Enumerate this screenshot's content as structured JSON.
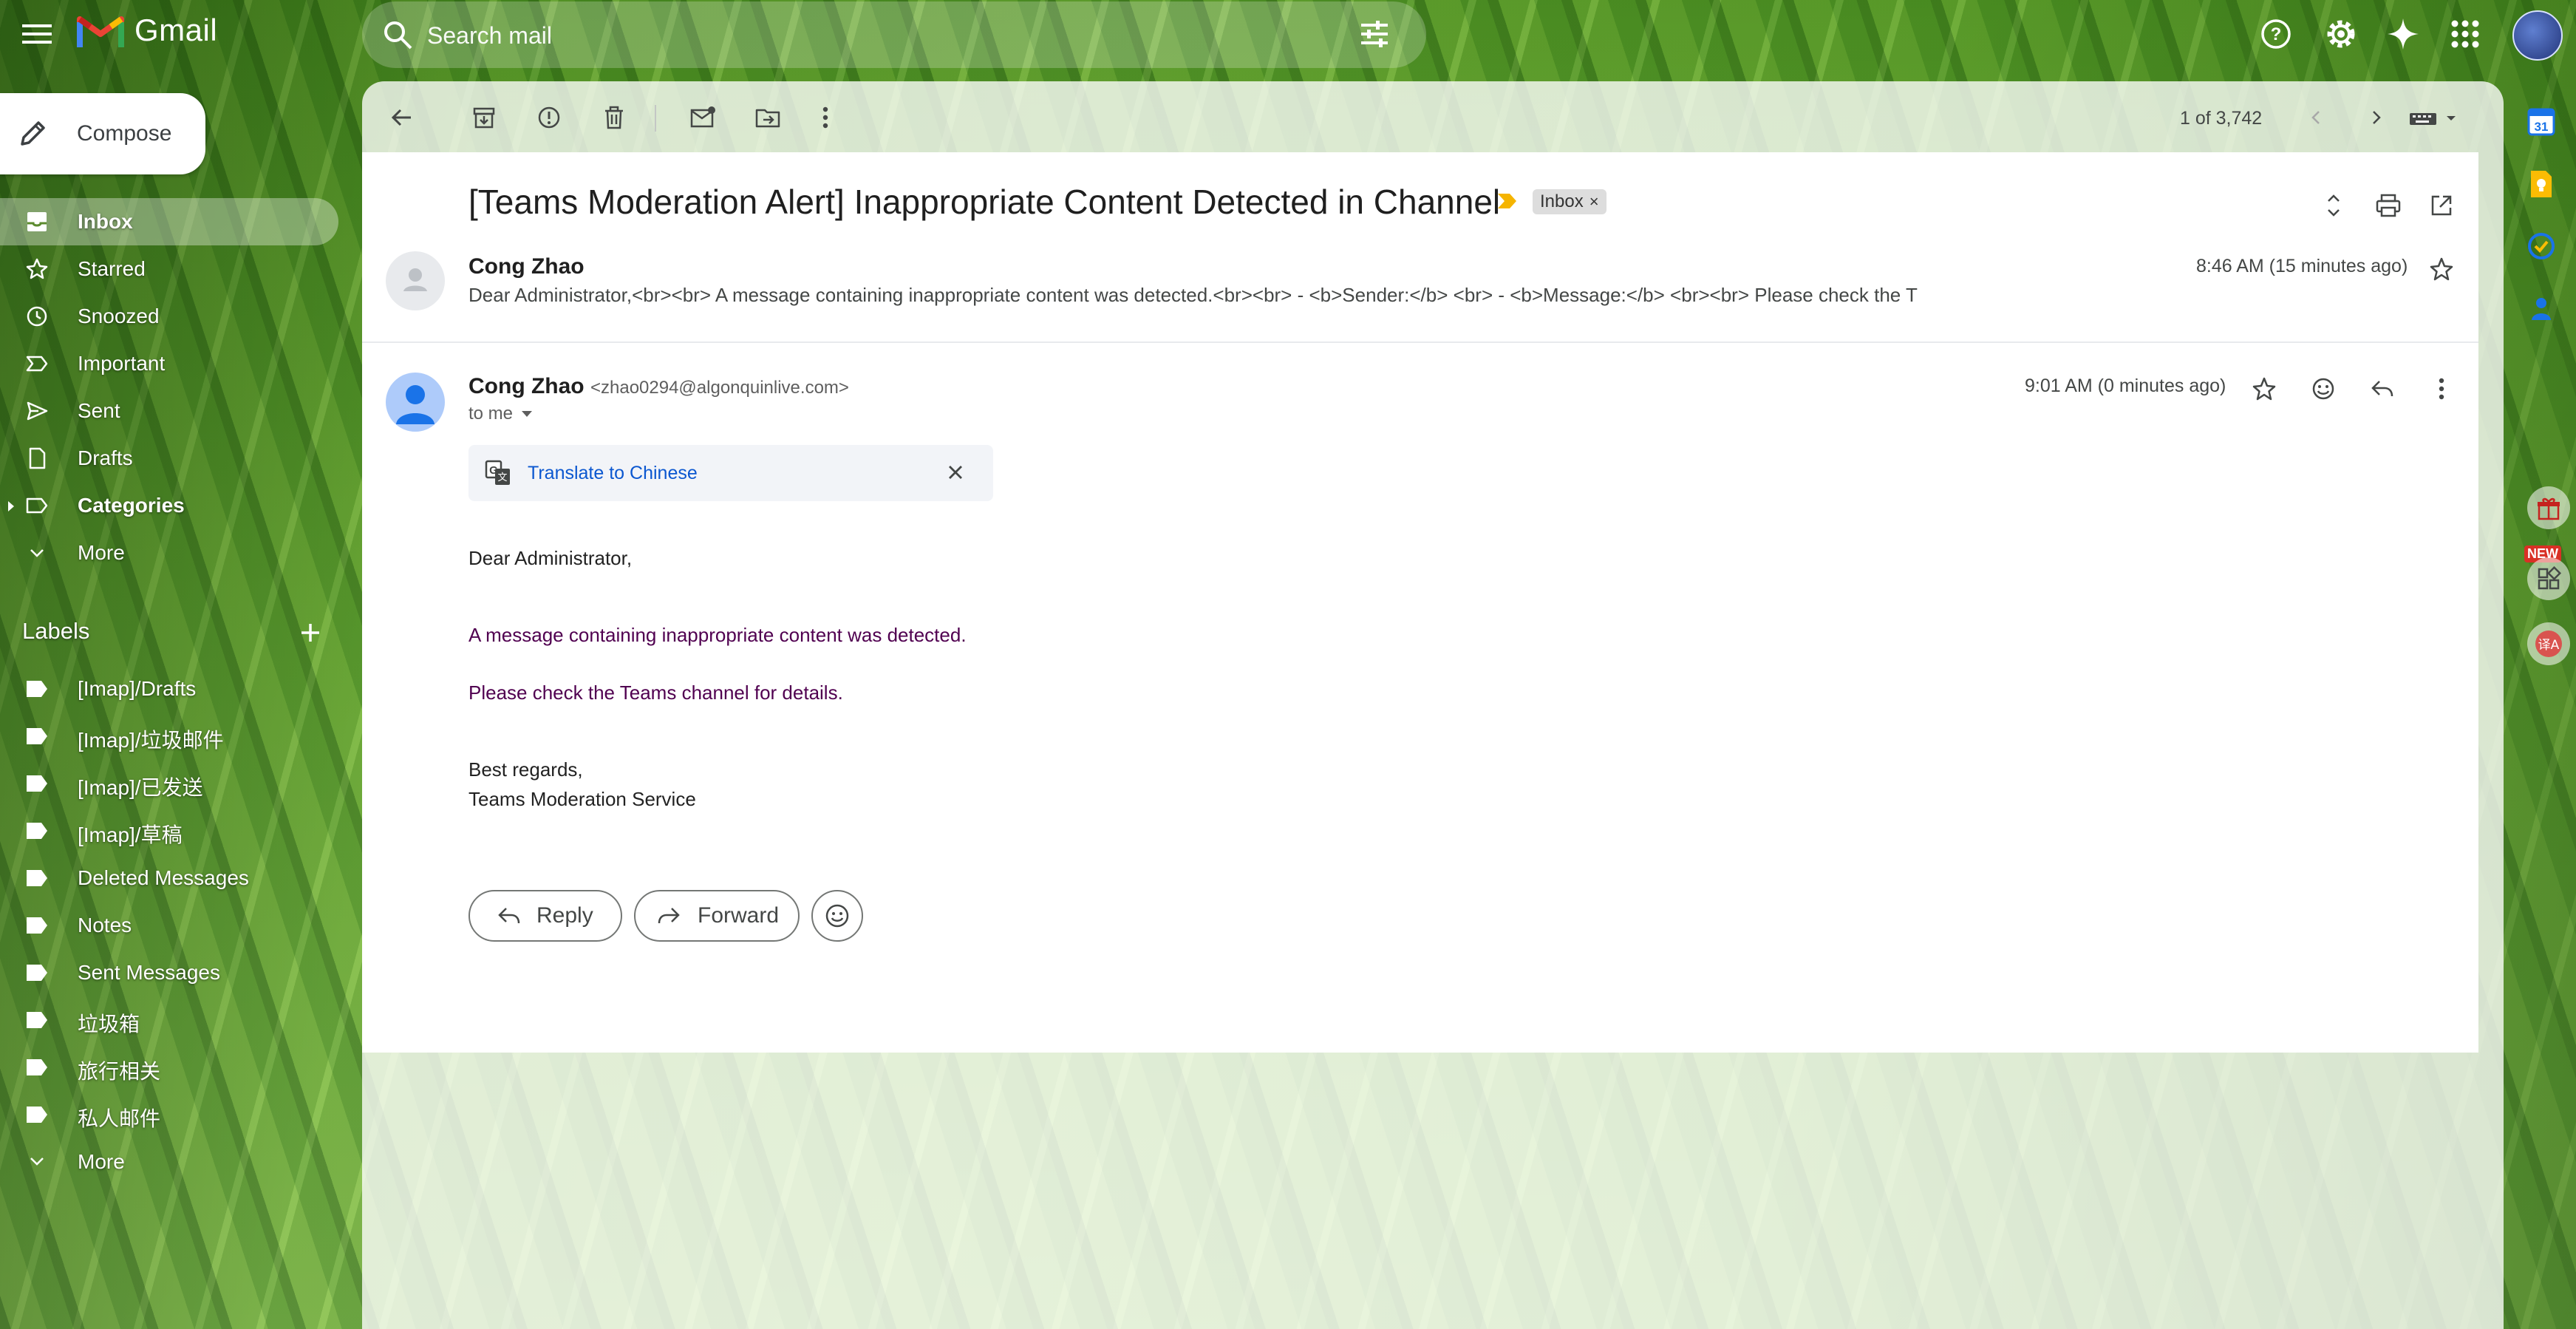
{
  "app": {
    "name": "Gmail"
  },
  "search": {
    "placeholder": "Search mail"
  },
  "compose": {
    "label": "Compose"
  },
  "nav": {
    "items": [
      {
        "label": "Inbox"
      },
      {
        "label": "Starred"
      },
      {
        "label": "Snoozed"
      },
      {
        "label": "Important"
      },
      {
        "label": "Sent"
      },
      {
        "label": "Drafts"
      },
      {
        "label": "Categories"
      },
      {
        "label": "More"
      }
    ]
  },
  "labels": {
    "heading": "Labels",
    "items": [
      {
        "label": "[Imap]/Drafts"
      },
      {
        "label": "[Imap]/垃圾邮件"
      },
      {
        "label": "[Imap]/已发送"
      },
      {
        "label": "[Imap]/草稿"
      },
      {
        "label": "Deleted Messages"
      },
      {
        "label": "Notes"
      },
      {
        "label": "Sent Messages"
      },
      {
        "label": "垃圾箱"
      },
      {
        "label": "旅行相关"
      },
      {
        "label": "私人邮件"
      },
      {
        "label": "More"
      }
    ]
  },
  "toolbar": {
    "pager": "1 of 3,742"
  },
  "thread": {
    "subject": "[Teams Moderation Alert] Inappropriate Content Detected in Channel",
    "label_chip": "Inbox",
    "chip_close": "×"
  },
  "message1": {
    "sender": "Cong Zhao",
    "snippet": "Dear Administrator,<br><br> A message containing inappropriate content was detected.<br><br> - <b>Sender:</b> <br> - <b>Message:</b> <br><br> Please check the T",
    "time": "8:46 AM (15 minutes ago)"
  },
  "message2": {
    "sender": "Cong Zhao",
    "email": "<zhao0294@algonquinlive.com>",
    "to": "to me",
    "time": "9:01 AM (0 minutes ago)",
    "translate": "Translate to Chinese",
    "body": {
      "greeting": "Dear Administrator,",
      "line1": "A message containing inappropriate content was detected.",
      "line2": "Please check the Teams channel for details.",
      "signoff1": "Best regards,",
      "signoff2": "Teams Moderation Service"
    }
  },
  "actions": {
    "reply": "Reply",
    "forward": "Forward"
  },
  "sidepanel": {
    "new_badge": "NEW",
    "calendar_day": "31"
  },
  "colors": {
    "accent_blue": "#0b57d0",
    "purple_text": "#500050",
    "important_marker": "#f5b400"
  }
}
